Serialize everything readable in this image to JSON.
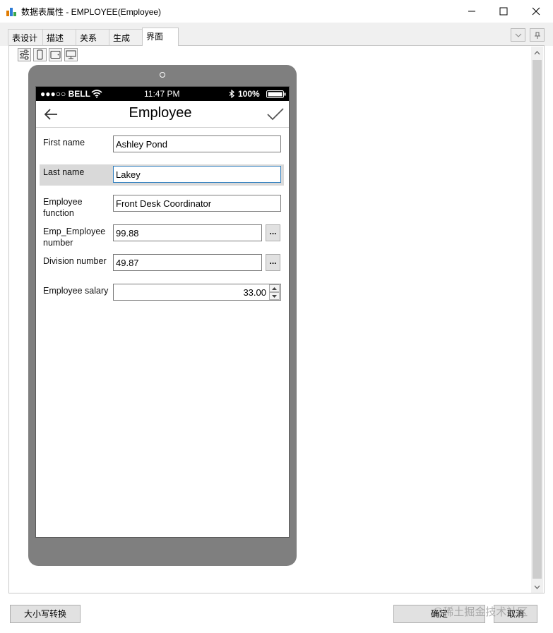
{
  "window": {
    "title": "数据表属性 - EMPLOYEE(Employee)"
  },
  "tabs": [
    {
      "label": "表设计"
    },
    {
      "label": "描述"
    },
    {
      "label": "关系"
    },
    {
      "label": "生成"
    },
    {
      "label": "界面",
      "active": true
    }
  ],
  "toolbar": {
    "icons": [
      "settings-sliders-icon",
      "phone-icon",
      "tablet-icon",
      "desktop-icon"
    ]
  },
  "phone": {
    "status": {
      "carrier": "●●●○○ BELL",
      "time": "11:47 PM",
      "battery": "100%"
    },
    "nav": {
      "title": "Employee"
    },
    "fields": [
      {
        "label": "First name",
        "value": "Ashley Pond"
      },
      {
        "label": "Last name",
        "value": "Lakey"
      },
      {
        "label": "Employee function",
        "value": "Front Desk Coordinator"
      },
      {
        "label": "Emp_Employee number",
        "value": "99.88",
        "lookup": "..."
      },
      {
        "label": "Division number",
        "value": "49.87",
        "lookup": "..."
      },
      {
        "label": "Employee salary",
        "value": "33.00"
      }
    ]
  },
  "footer": {
    "case_convert_label": "大小写转换",
    "ok_label": "确定",
    "cancel_label": "取消",
    "watermark": "@稀土掘金技术社区"
  },
  "colors": {
    "phone_frame": "#7f7f7f",
    "focus_border": "#2f7fbf",
    "row_highlight": "#d9d9d9"
  }
}
